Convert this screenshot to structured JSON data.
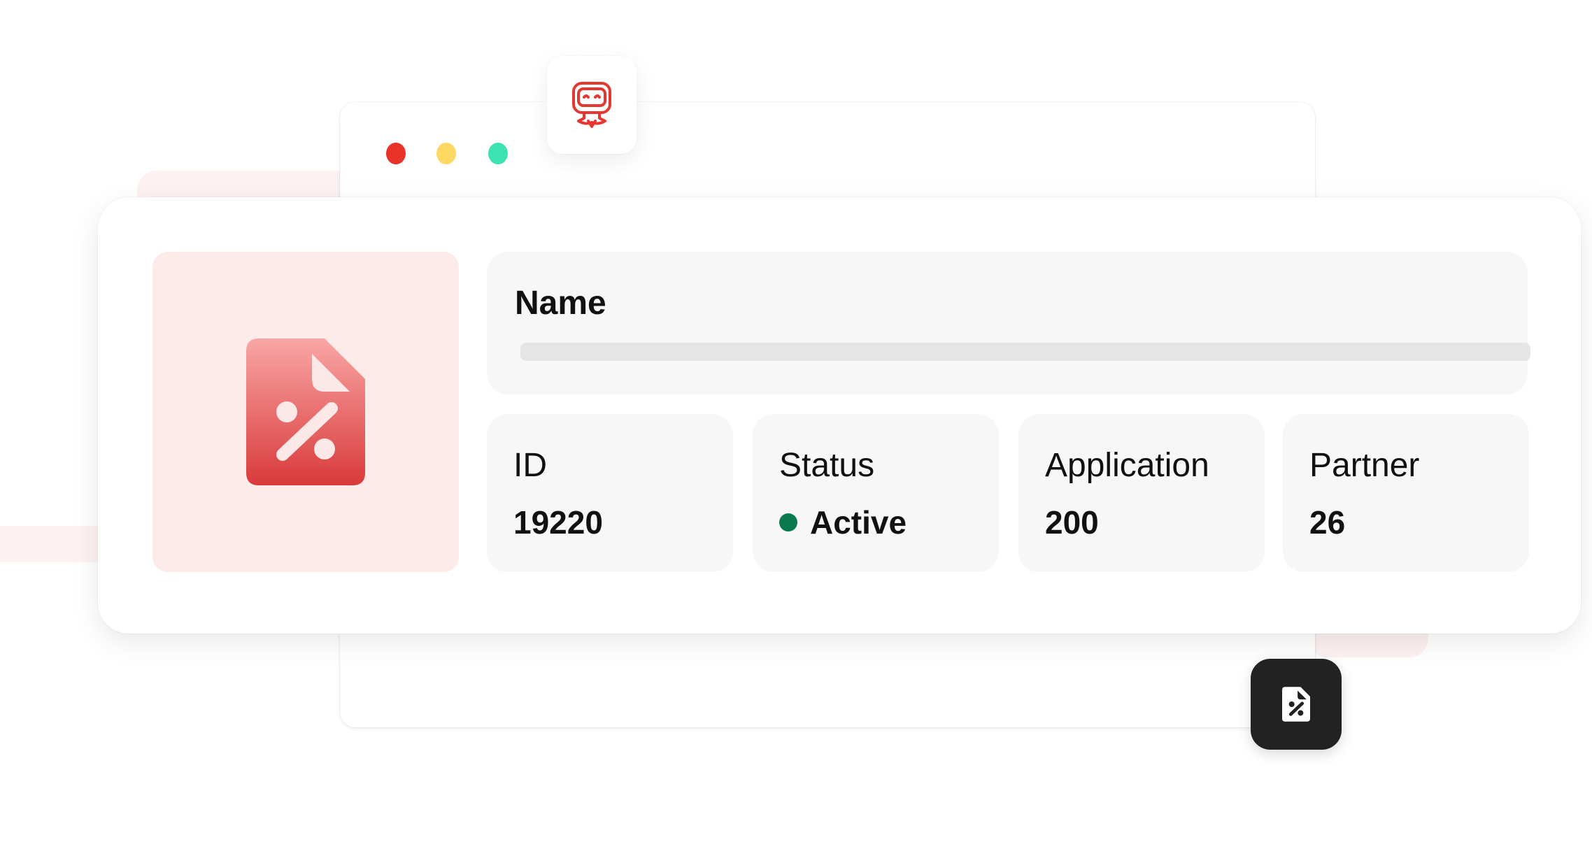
{
  "window": {
    "traffic_lights": [
      "#e9322a",
      "#fdd964",
      "#3de2b0"
    ]
  },
  "icons": {
    "robot": "robot-logo-icon",
    "product": "percent-document-icon",
    "fab": "percent-document-icon"
  },
  "colors": {
    "accent": "#e24a4a",
    "thumb_bg": "#fdebea",
    "status_active": "#0a7a4e",
    "fab_bg": "#222222"
  },
  "record": {
    "name_label": "Name",
    "fields": [
      {
        "label": "ID",
        "value": "19220"
      },
      {
        "label": "Status",
        "value": "Active"
      },
      {
        "label": "Application",
        "value": "200"
      },
      {
        "label": "Partner",
        "value": "26"
      }
    ]
  }
}
